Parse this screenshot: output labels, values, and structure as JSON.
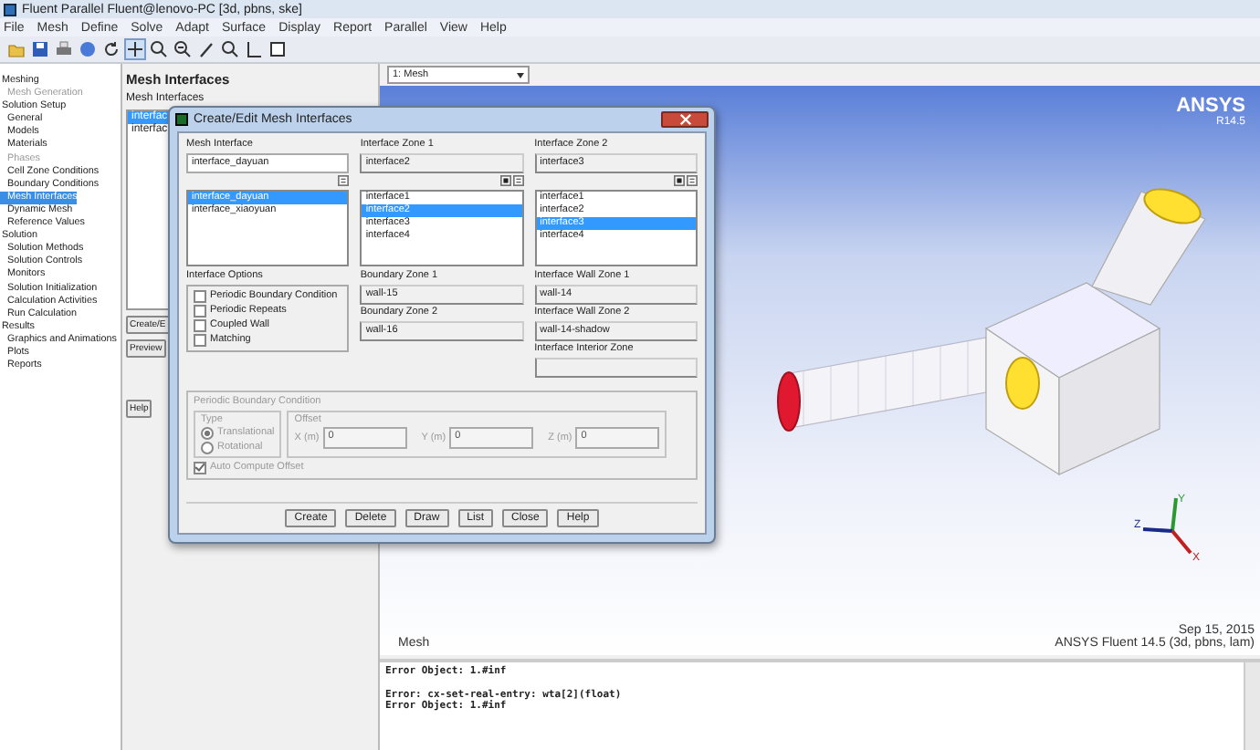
{
  "window": {
    "title": "Fluent Parallel Fluent@lenovo-PC  [3d, pbns, ske]"
  },
  "menu": [
    "File",
    "Mesh",
    "Define",
    "Solve",
    "Adapt",
    "Surface",
    "Display",
    "Report",
    "Parallel",
    "View",
    "Help"
  ],
  "tree": [
    {
      "label": "Meshing",
      "disabled": false,
      "selected": false,
      "children": [
        {
          "label": "Mesh Generation",
          "disabled": true,
          "selected": false
        }
      ]
    },
    {
      "label": "Solution Setup",
      "disabled": false,
      "selected": false,
      "children": [
        {
          "label": "General",
          "disabled": false,
          "selected": false
        },
        {
          "label": "Models",
          "disabled": false,
          "selected": false
        },
        {
          "label": "Materials",
          "disabled": false,
          "selected": false
        },
        {
          "label": "Phases",
          "disabled": true,
          "selected": false
        },
        {
          "label": "Cell Zone Conditions",
          "disabled": false,
          "selected": false
        },
        {
          "label": "Boundary Conditions",
          "disabled": false,
          "selected": false
        },
        {
          "label": "Mesh Interfaces",
          "disabled": false,
          "selected": true
        },
        {
          "label": "Dynamic Mesh",
          "disabled": false,
          "selected": false
        },
        {
          "label": "Reference Values",
          "disabled": false,
          "selected": false
        }
      ]
    },
    {
      "label": "Solution",
      "disabled": false,
      "selected": false,
      "children": [
        {
          "label": "Solution Methods",
          "disabled": false,
          "selected": false
        },
        {
          "label": "Solution Controls",
          "disabled": false,
          "selected": false
        },
        {
          "label": "Monitors",
          "disabled": false,
          "selected": false
        },
        {
          "label": "Solution Initialization",
          "disabled": false,
          "selected": false
        },
        {
          "label": "Calculation Activities",
          "disabled": false,
          "selected": false
        },
        {
          "label": "Run Calculation",
          "disabled": false,
          "selected": false
        }
      ]
    },
    {
      "label": "Results",
      "disabled": false,
      "selected": false,
      "children": [
        {
          "label": "Graphics and Animations",
          "disabled": false,
          "selected": false
        },
        {
          "label": "Plots",
          "disabled": false,
          "selected": false
        },
        {
          "label": "Reports",
          "disabled": false,
          "selected": false
        }
      ]
    }
  ],
  "panel": {
    "title": "Mesh Interfaces",
    "list_label": "Mesh Interfaces",
    "items": [
      {
        "label": "interfac",
        "selected": true
      },
      {
        "label": "interfac",
        "selected": false
      }
    ],
    "buttons": [
      "Create/E",
      "Preview"
    ],
    "help": "Help"
  },
  "graphics": {
    "view_select": "1: Mesh",
    "logo": "ANSYS",
    "version": "R14.5",
    "axes": [
      "X",
      "Y",
      "Z"
    ],
    "caption": "Mesh",
    "date": "Sep 15, 2015",
    "product": "ANSYS Fluent 14.5 (3d, pbns, lam)"
  },
  "console": {
    "blocks": [
      [
        "Error Object: 1.#inf"
      ],
      [
        "Error: cx-set-real-entry: wta[2](float)",
        "Error Object: 1.#inf"
      ]
    ]
  },
  "dialog": {
    "title": "Create/Edit Mesh Interfaces",
    "selectors": [
      {
        "label": "Mesh Interface",
        "value": "interface_dayuan",
        "editable": true,
        "items": [
          {
            "label": "interface_dayuan",
            "selected": true
          },
          {
            "label": "interface_xiaoyuan",
            "selected": false
          }
        ]
      },
      {
        "label": "Interface Zone 1",
        "value": "interface2",
        "editable": false,
        "items": [
          {
            "label": "interface1",
            "selected": false
          },
          {
            "label": "interface2",
            "selected": true
          },
          {
            "label": "interface3",
            "selected": false
          },
          {
            "label": "interface4",
            "selected": false
          }
        ]
      },
      {
        "label": "Interface Zone 2",
        "value": "interface3",
        "editable": false,
        "items": [
          {
            "label": "interface1",
            "selected": false
          },
          {
            "label": "interface2",
            "selected": false
          },
          {
            "label": "interface3",
            "selected": true
          },
          {
            "label": "interface4",
            "selected": false
          }
        ]
      }
    ],
    "options": {
      "label": "Interface Options",
      "checkboxes": [
        {
          "label": "Periodic Boundary Condition",
          "checked": false
        },
        {
          "label": "Periodic Repeats",
          "checked": false
        },
        {
          "label": "Coupled Wall",
          "checked": false
        },
        {
          "label": "Matching",
          "checked": false
        }
      ]
    },
    "boundary_fields": [
      {
        "label": "Boundary Zone 1",
        "value": "wall-15"
      },
      {
        "label": "Boundary Zone 2",
        "value": "wall-16"
      }
    ],
    "wall_fields": [
      {
        "label": "Interface Wall Zone 1",
        "value": "wall-14"
      },
      {
        "label": "Interface Wall Zone 2",
        "value": "wall-14-shadow"
      },
      {
        "label": "Interface Interior Zone"
      }
    ],
    "periodic": {
      "label": "Periodic Boundary Condition",
      "disabled": true,
      "type_label": "Type",
      "types": [
        {
          "label": "Translational",
          "selected": true
        },
        {
          "label": "Rotational",
          "selected": false
        }
      ],
      "offset_label": "Offset",
      "offsets": [
        {
          "label": "X (m)",
          "value": "0"
        },
        {
          "label": "Y (m)",
          "value": "0"
        },
        {
          "label": "Z (m)",
          "value": "0"
        }
      ],
      "auto": {
        "label": "Auto Compute Offset",
        "checked": true
      }
    },
    "buttons": [
      "Create",
      "Delete",
      "Draw",
      "List",
      "Close",
      "Help"
    ]
  }
}
